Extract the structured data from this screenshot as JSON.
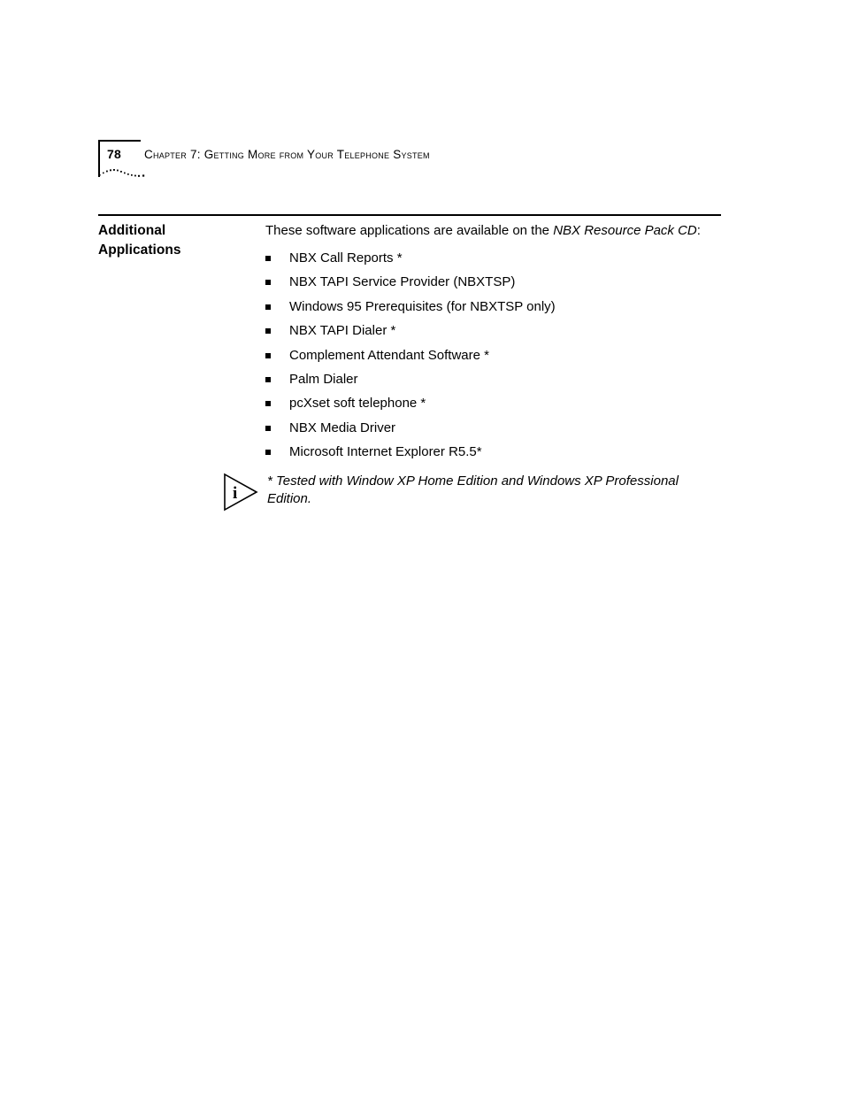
{
  "document": {
    "page_number": "78",
    "running_header": "Chapter 7: Getting More from Your Telephone System"
  },
  "section": {
    "heading_line1": "Additional",
    "heading_line2": "Applications",
    "intro_before": "These software applications are available on the ",
    "intro_italic": "NBX Resource Pack CD",
    "intro_after": ":",
    "items": [
      "NBX Call Reports *",
      "NBX TAPI Service Provider (NBXTSP)",
      "Windows 95 Prerequisites (for NBXTSP only)",
      "NBX TAPI Dialer *",
      "Complement Attendant Software *",
      "Palm Dialer",
      "pcXset soft telephone *",
      "NBX Media Driver",
      "Microsoft Internet Explorer R5.5*"
    ]
  },
  "note": {
    "icon": "info-triangle-icon",
    "icon_letter": "i",
    "text": "* Tested with Window XP Home Edition and Windows XP Professional Edition."
  },
  "colors": {
    "text": "#000000",
    "rule": "#000000",
    "background": "#ffffff"
  }
}
